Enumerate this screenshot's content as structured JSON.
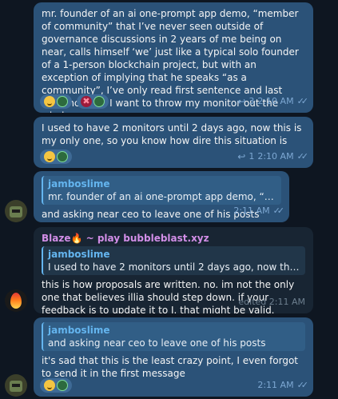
{
  "messages": [
    {
      "text": "mr. founder of an ai one-prompt app demo, “member of community” that I’ve never seen outside of governance discussions in 2 years of me being on near, calls himself ‘we’ just like a typical solo founder of a 1-person blockchain project, but with an exception of implying that he speaks “as a community”, I’ve only read first sentence and last sentence and I want to throw my monitor out the window",
      "reply_count": "3",
      "time": "2:10 AM",
      "reactions": [
        "smile-emoji",
        "cross-emoji"
      ]
    },
    {
      "text": "I used to have 2 monitors until 2 days ago, now this is my only one, so you know how dire this situation is",
      "reply_count": "1",
      "time": "2:10 AM",
      "reactions": [
        "smile-emoji"
      ]
    },
    {
      "quote_name": "jamboslime",
      "quote_text": "mr. founder of an ai one-prompt app demo, “member...",
      "text": "and asking near ceo to leave one of his posts",
      "time": "2:11 AM"
    },
    {
      "sender": "Blaze🔥 ~ play bubbleblast.xyz",
      "quote_name": "jamboslime",
      "quote_text": "I used to have 2 monitors until 2 days ago, now this is my onl...",
      "text": "this is how proposals are written. no. im not the only one that believes illia should step down. if your feedback is to update it to I. that might be valid.",
      "time": "edited 2:11 AM"
    },
    {
      "quote_name": "jamboslime",
      "quote_text": "and asking near ceo to leave one of his posts",
      "text": "it's sad that this is the least crazy point, I even forgot to send it in the first message",
      "time": "2:11 AM",
      "reactions": [
        "smile-emoji"
      ]
    }
  ],
  "icons": {
    "reply": "↩",
    "checks": "✓✓"
  },
  "colors": {
    "background": "#0e1621",
    "outgoing_bubble": "#2b5278",
    "incoming_bubble": "#182533",
    "accent": "#64b5ef",
    "sender_name": "#d28ee7"
  }
}
